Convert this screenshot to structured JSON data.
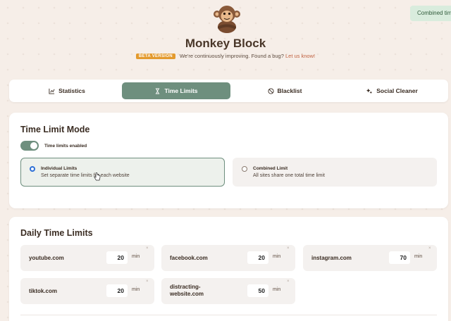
{
  "toast": "Combined tim",
  "app": {
    "title": "Monkey Block"
  },
  "beta": {
    "badge": "BETA VERSION",
    "message": "We're continuously improving. Found a bug?",
    "link": "Let us know!"
  },
  "tabs": [
    {
      "label": "Statistics",
      "icon": "chart-icon",
      "active": false
    },
    {
      "label": "Time Limits",
      "icon": "hourglass-icon",
      "active": true
    },
    {
      "label": "Blacklist",
      "icon": "block-icon",
      "active": false
    },
    {
      "label": "Social Cleaner",
      "icon": "sparkle-icon",
      "active": false
    }
  ],
  "time_limit_mode": {
    "title": "Time Limit Mode",
    "toggle_label": "Time limits enabled",
    "toggle_on": true,
    "modes": [
      {
        "title": "Individual Limits",
        "desc": "Set separate time limits for each website",
        "selected": true
      },
      {
        "title": "Combined Limit",
        "desc": "All sites share one total time limit",
        "selected": false
      }
    ]
  },
  "daily_limits": {
    "title": "Daily Time Limits",
    "unit": "min",
    "remove": "×",
    "sites": [
      {
        "name": "youtube.com",
        "value": "20"
      },
      {
        "name": "facebook.com",
        "value": "20"
      },
      {
        "name": "instagram.com",
        "value": "70"
      },
      {
        "name": "tiktok.com",
        "value": "20"
      },
      {
        "name": "distracting-website.com",
        "name_l1": "distracting-",
        "name_l2": "website.com",
        "value": "50"
      }
    ]
  },
  "colors": {
    "accent": "#6e8f7e",
    "beta": "#e39a2e",
    "link": "#c0603f",
    "background": "#f6eee8"
  }
}
